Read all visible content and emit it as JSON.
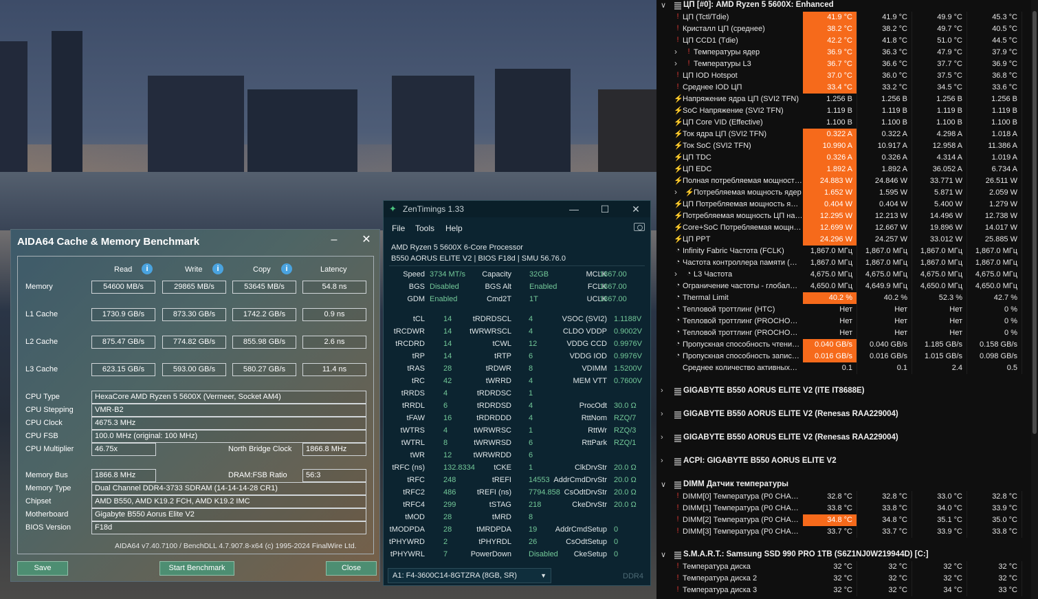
{
  "aida": {
    "title": "AIDA64 Cache & Memory Benchmark",
    "min": "–",
    "close": "✕",
    "cols": [
      "Read",
      "Write",
      "Copy",
      "Latency"
    ],
    "rows": [
      {
        "label": "Memory",
        "values": [
          "54600 MB/s",
          "29865 MB/s",
          "53645 MB/s",
          "54.8 ns"
        ]
      },
      {
        "label": "L1 Cache",
        "values": [
          "1730.9 GB/s",
          "873.30 GB/s",
          "1742.2 GB/s",
          "0.9 ns"
        ]
      },
      {
        "label": "L2 Cache",
        "values": [
          "875.47 GB/s",
          "774.82 GB/s",
          "855.98 GB/s",
          "2.6 ns"
        ]
      },
      {
        "label": "L3 Cache",
        "values": [
          "623.15 GB/s",
          "593.00 GB/s",
          "580.27 GB/s",
          "11.4 ns"
        ]
      }
    ],
    "cpu_type_label": "CPU Type",
    "cpu_type": "HexaCore AMD Ryzen 5 5600X  (Vermeer, Socket AM4)",
    "cpu_stepping_label": "CPU Stepping",
    "cpu_stepping": "VMR-B2",
    "cpu_clock_label": "CPU Clock",
    "cpu_clock": "4675.3 MHz",
    "cpu_fsb_label": "CPU FSB",
    "cpu_fsb": "100.0 MHz  (original: 100 MHz)",
    "cpu_mult_label": "CPU Multiplier",
    "cpu_mult": "46.75x",
    "nb_clock_label": "North Bridge Clock",
    "nb_clock": "1866.8 MHz",
    "mem_bus_label": "Memory Bus",
    "mem_bus": "1866.8 MHz",
    "dram_ratio_label": "DRAM:FSB Ratio",
    "dram_ratio": "56:3",
    "mem_type_label": "Memory Type",
    "mem_type": "Dual Channel DDR4-3733 SDRAM  (14-14-14-28 CR1)",
    "chipset_label": "Chipset",
    "chipset": "AMD B550, AMD K19.2 FCH, AMD K19.2 IMC",
    "mobo_label": "Motherboard",
    "mobo": "Gigabyte B550 Aorus Elite V2",
    "bios_label": "BIOS Version",
    "bios": "F18d",
    "footer": "AIDA64 v7.40.7100 / BenchDLL 4.7.907.8-x64  (c) 1995-2024 FinalWire Ltd.",
    "save": "Save",
    "start": "Start Benchmark",
    "close_btn": "Close"
  },
  "zen": {
    "title": "ZenTimings 1.33",
    "menu": [
      "File",
      "Tools",
      "Help"
    ],
    "cpu": "AMD Ryzen 5 5600X 6-Core Processor",
    "board": "B550 AORUS ELITE V2 | BIOS F18d | SMU 56.76.0",
    "top": [
      [
        "Speed",
        "3734 MT/s",
        "Capacity",
        "32GB",
        "MCLK",
        "1867.00"
      ],
      [
        "BGS",
        "Disabled",
        "BGS Alt",
        "Enabled",
        "FCLK",
        "1867.00"
      ],
      [
        "GDM",
        "Enabled",
        "Cmd2T",
        "1T",
        "UCLK",
        "1867.00"
      ]
    ],
    "timings": [
      [
        "tCL",
        "14",
        "tRDRDSCL",
        "4",
        "VSOC (SVI2)",
        "1.1188V"
      ],
      [
        "tRCDWR",
        "14",
        "tWRWRSCL",
        "4",
        "CLDO VDDP",
        "0.9002V"
      ],
      [
        "tRCDRD",
        "14",
        "tCWL",
        "12",
        "VDDG CCD",
        "0.9976V"
      ],
      [
        "tRP",
        "14",
        "tRTP",
        "6",
        "VDDG IOD",
        "0.9976V"
      ],
      [
        "tRAS",
        "28",
        "tRDWR",
        "8",
        "VDIMM",
        "1.5200V"
      ],
      [
        "tRC",
        "42",
        "tWRRD",
        "4",
        "MEM VTT",
        "0.7600V"
      ],
      [
        "tRRDS",
        "4",
        "tRDRDSC",
        "1",
        "",
        ""
      ],
      [
        "tRRDL",
        "6",
        "tRDRDSD",
        "4",
        "ProcOdt",
        "30.0 Ω"
      ],
      [
        "tFAW",
        "16",
        "tRDRDDD",
        "4",
        "RttNom",
        "RZQ/7"
      ],
      [
        "tWTRS",
        "4",
        "tWRWRSC",
        "1",
        "RttWr",
        "RZQ/3"
      ],
      [
        "tWTRL",
        "8",
        "tWRWRSD",
        "6",
        "RttPark",
        "RZQ/1"
      ],
      [
        "tWR",
        "12",
        "tWRWRDD",
        "6",
        "",
        ""
      ],
      [
        "tRFC (ns)",
        "132.8334",
        "tCKE",
        "1",
        "ClkDrvStr",
        "20.0 Ω"
      ],
      [
        "tRFC",
        "248",
        "tREFI",
        "14553",
        "AddrCmdDrvStr",
        "20.0 Ω"
      ],
      [
        "tRFC2",
        "486",
        "tREFI (ns)",
        "7794.858",
        "CsOdtDrvStr",
        "20.0 Ω"
      ],
      [
        "tRFC4",
        "299",
        "tSTAG",
        "218",
        "CkeDrvStr",
        "20.0 Ω"
      ],
      [
        "tMOD",
        "28",
        "tMRD",
        "8",
        "",
        ""
      ],
      [
        "tMODPDA",
        "28",
        "tMRDPDA",
        "19",
        "AddrCmdSetup",
        "0"
      ],
      [
        "tPHYWRD",
        "2",
        "tPHYRDL",
        "26",
        "CsOdtSetup",
        "0"
      ],
      [
        "tPHYWRL",
        "7",
        "PowerDown",
        "Disabled",
        "CkeSetup",
        "0"
      ]
    ],
    "module": "A1: F4-3600C14-8GTZRA (8GB, SR)",
    "ddr": "DDR4"
  },
  "hw": {
    "rows": [
      {
        "t": "h",
        "exp": "∨",
        "name": "ЦП [#0]: AMD Ryzen 5 5600X: Enhanced"
      },
      {
        "t": "s",
        "ic": "!",
        "icc": "#e53935",
        "ind": 0,
        "name": "ЦП (Tctl/Tdie)",
        "v": [
          "41.9 °C",
          "41.9 °C",
          "49.9 °C",
          "45.3 °C"
        ],
        "hot": true
      },
      {
        "t": "s",
        "ic": "!",
        "icc": "#e53935",
        "ind": 0,
        "name": "Кристалл ЦП (среднее)",
        "v": [
          "38.2 °C",
          "38.2 °C",
          "49.7 °C",
          "40.5 °C"
        ],
        "hot": true
      },
      {
        "t": "s",
        "ic": "!",
        "icc": "#e53935",
        "ind": 0,
        "name": "ЦП CCD1 (Tdie)",
        "v": [
          "42.2 °C",
          "41.8 °C",
          "51.0 °C",
          "44.5 °C"
        ],
        "hot": true
      },
      {
        "t": "s",
        "ic": "!",
        "icc": "#e53935",
        "ind": 1,
        "name": "Температуры ядер",
        "v": [
          "36.9 °C",
          "36.3 °C",
          "47.9 °C",
          "37.9 °C"
        ],
        "hot": true
      },
      {
        "t": "s",
        "ic": "!",
        "icc": "#e53935",
        "ind": 1,
        "name": "Температуры L3",
        "v": [
          "36.7 °C",
          "36.6 °C",
          "37.7 °C",
          "36.9 °C"
        ],
        "hot": true
      },
      {
        "t": "s",
        "ic": "!",
        "icc": "#e53935",
        "ind": 0,
        "name": "ЦП IOD Hotspot",
        "v": [
          "37.0 °C",
          "36.0 °C",
          "37.5 °C",
          "36.8 °C"
        ],
        "hot": true
      },
      {
        "t": "s",
        "ic": "!",
        "icc": "#e53935",
        "ind": 0,
        "name": "Среднее IOD ЦП",
        "v": [
          "33.4 °C",
          "33.2 °C",
          "34.5 °C",
          "33.6 °C"
        ],
        "hot": true
      },
      {
        "t": "s",
        "ic": "⚡",
        "icc": "#f5c518",
        "ind": 0,
        "name": "Напряжение ядра ЦП (SVI2 TFN)",
        "v": [
          "1.256 В",
          "1.256 В",
          "1.256 В",
          "1.256 В"
        ],
        "hot": false
      },
      {
        "t": "s",
        "ic": "⚡",
        "icc": "#f5c518",
        "ind": 0,
        "name": "SoC Напряжение (SVI2 TFN)",
        "v": [
          "1.119 В",
          "1.119 В",
          "1.119 В",
          "1.119 В"
        ],
        "hot": false
      },
      {
        "t": "s",
        "ic": "⚡",
        "icc": "#f5c518",
        "ind": 0,
        "name": "ЦП Core VID (Effective)",
        "v": [
          "1.100 В",
          "1.100 В",
          "1.100 В",
          "1.100 В"
        ],
        "hot": false
      },
      {
        "t": "s",
        "ic": "⚡",
        "icc": "#f5c518",
        "ind": 0,
        "name": "Ток ядра ЦП (SVI2 TFN)",
        "v": [
          "0.322 A",
          "0.322 A",
          "4.298 A",
          "1.018 A"
        ],
        "hot": true
      },
      {
        "t": "s",
        "ic": "⚡",
        "icc": "#f5c518",
        "ind": 0,
        "name": "Ток SoC (SVI2 TFN)",
        "v": [
          "10.990 A",
          "10.917 A",
          "12.958 A",
          "11.386 A"
        ],
        "hot": true
      },
      {
        "t": "s",
        "ic": "⚡",
        "icc": "#f5c518",
        "ind": 0,
        "name": "ЦП TDC",
        "v": [
          "0.326 A",
          "0.326 A",
          "4.314 A",
          "1.019 A"
        ],
        "hot": true
      },
      {
        "t": "s",
        "ic": "⚡",
        "icc": "#f5c518",
        "ind": 0,
        "name": "ЦП EDC",
        "v": [
          "1.892 A",
          "1.892 A",
          "36.052 A",
          "6.734 A"
        ],
        "hot": true
      },
      {
        "t": "s",
        "ic": "⚡",
        "icc": "#f5c518",
        "ind": 0,
        "name": "Полная потребляемая мощност…",
        "v": [
          "24.883 W",
          "24.846 W",
          "33.771 W",
          "26.511 W"
        ],
        "hot": true
      },
      {
        "t": "s",
        "ic": "⚡",
        "icc": "#f5c518",
        "ind": 1,
        "name": "Потребляемая мощность ядер",
        "v": [
          "1.652 W",
          "1.595 W",
          "5.871 W",
          "2.059 W"
        ],
        "hot": true
      },
      {
        "t": "s",
        "ic": "⚡",
        "icc": "#f5c518",
        "ind": 0,
        "name": "ЦП Потребляемая мощность я…",
        "v": [
          "0.404 W",
          "0.404 W",
          "5.400 W",
          "1.279 W"
        ],
        "hot": true
      },
      {
        "t": "s",
        "ic": "⚡",
        "icc": "#f5c518",
        "ind": 0,
        "name": "Потребляемая мощность ЦП на…",
        "v": [
          "12.295 W",
          "12.213 W",
          "14.496 W",
          "12.738 W"
        ],
        "hot": true
      },
      {
        "t": "s",
        "ic": "⚡",
        "icc": "#f5c518",
        "ind": 0,
        "name": "Core+SoC Потребляемая мощн…",
        "v": [
          "12.699 W",
          "12.667 W",
          "19.896 W",
          "14.017 W"
        ],
        "hot": true
      },
      {
        "t": "s",
        "ic": "⚡",
        "icc": "#f5c518",
        "ind": 0,
        "name": "ЦП PPT",
        "v": [
          "24.296 W",
          "24.257 W",
          "33.012 W",
          "25.885 W"
        ],
        "hot": true
      },
      {
        "t": "s",
        "ic": "◔",
        "icc": "#cfcfcf",
        "ind": 0,
        "name": "Infinity Fabric Частота (FCLK)",
        "v": [
          "1,867.0 МГц",
          "1,867.0 МГц",
          "1,867.0 МГц",
          "1,867.0 МГц"
        ],
        "hot": false
      },
      {
        "t": "s",
        "ic": "◔",
        "icc": "#cfcfcf",
        "ind": 0,
        "name": "Частота контроллера памяти (…",
        "v": [
          "1,867.0 МГц",
          "1,867.0 МГц",
          "1,867.0 МГц",
          "1,867.0 МГц"
        ],
        "hot": false
      },
      {
        "t": "s",
        "ic": "◔",
        "icc": "#cfcfcf",
        "ind": 1,
        "name": "L3 Частота",
        "v": [
          "4,675.0 МГц",
          "4,675.0 МГц",
          "4,675.0 МГц",
          "4,675.0 МГц"
        ],
        "hot": false
      },
      {
        "t": "s",
        "ic": "◔",
        "icc": "#cfcfcf",
        "ind": 0,
        "name": "Ограничение частоты - глобал…",
        "v": [
          "4,650.0 МГц",
          "4,649.9 МГц",
          "4,650.0 МГц",
          "4,650.0 МГц"
        ],
        "hot": false
      },
      {
        "t": "s",
        "ic": "◔",
        "icc": "#cfcfcf",
        "ind": 0,
        "name": "Thermal Limit",
        "v": [
          "40.2 %",
          "40.2 %",
          "52.3 %",
          "42.7 %"
        ],
        "hot": true
      },
      {
        "t": "s",
        "ic": "◔",
        "icc": "#cfcfcf",
        "ind": 0,
        "name": "Тепловой троттлинг (HTC)",
        "v": [
          "Нет",
          "Нет",
          "Нет",
          "0 %"
        ],
        "hot": false
      },
      {
        "t": "s",
        "ic": "◔",
        "icc": "#cfcfcf",
        "ind": 0,
        "name": "Тепловой троттлинг (PROCHO…",
        "v": [
          "Нет",
          "Нет",
          "Нет",
          "0 %"
        ],
        "hot": false
      },
      {
        "t": "s",
        "ic": "◔",
        "icc": "#cfcfcf",
        "ind": 0,
        "name": "Тепловой троттлинг (PROCHO…",
        "v": [
          "Нет",
          "Нет",
          "Нет",
          "0 %"
        ],
        "hot": false
      },
      {
        "t": "s",
        "ic": "◔",
        "icc": "#cfcfcf",
        "ind": 0,
        "name": "Пропускная способность чтени…",
        "v": [
          "0.040 GB/s",
          "0.040 GB/s",
          "1.185 GB/s",
          "0.158 GB/s"
        ],
        "hot": true
      },
      {
        "t": "s",
        "ic": "◔",
        "icc": "#cfcfcf",
        "ind": 0,
        "name": "Пропускная способность запис…",
        "v": [
          "0.016 GB/s",
          "0.016 GB/s",
          "1.015 GB/s",
          "0.098 GB/s"
        ],
        "hot": true
      },
      {
        "t": "s",
        "ic": "",
        "icc": "#cfcfcf",
        "ind": 0,
        "name": "Среднее количество активных…",
        "v": [
          "0.1",
          "0.1",
          "2.4",
          "0.5"
        ],
        "hot": false
      },
      {
        "t": "g"
      },
      {
        "t": "h",
        "exp": "›",
        "name": "GIGABYTE B550 AORUS ELITE V2 (ITE IT8688E)"
      },
      {
        "t": "g"
      },
      {
        "t": "h",
        "exp": "›",
        "name": "GIGABYTE B550 AORUS ELITE V2 (Renesas RAA229004)"
      },
      {
        "t": "g"
      },
      {
        "t": "h",
        "exp": "›",
        "name": "GIGABYTE B550 AORUS ELITE V2 (Renesas RAA229004)"
      },
      {
        "t": "g"
      },
      {
        "t": "h",
        "exp": "›",
        "name": "ACPI: GIGABYTE B550 AORUS ELITE V2"
      },
      {
        "t": "g"
      },
      {
        "t": "h",
        "exp": "∨",
        "name": "DIMM Датчик температуры"
      },
      {
        "t": "s",
        "ic": "!",
        "icc": "#e53935",
        "ind": 0,
        "name": "DIMM[0] Температура (P0 CHA…",
        "v": [
          "32.8 °C",
          "32.8 °C",
          "33.0 °C",
          "32.8 °C"
        ],
        "hot": false
      },
      {
        "t": "s",
        "ic": "!",
        "icc": "#e53935",
        "ind": 0,
        "name": "DIMM[1] Температура (P0 CHA…",
        "v": [
          "33.8 °C",
          "33.8 °C",
          "34.0 °C",
          "33.9 °C"
        ],
        "hot": false
      },
      {
        "t": "s",
        "ic": "!",
        "icc": "#e53935",
        "ind": 0,
        "name": "DIMM[2] Температура (P0 CHA…",
        "v": [
          "34.8 °C",
          "34.8 °C",
          "35.1 °C",
          "35.0 °C"
        ],
        "hot": true
      },
      {
        "t": "s",
        "ic": "!",
        "icc": "#e53935",
        "ind": 0,
        "name": "DIMM[3] Температура (P0 CHA…",
        "v": [
          "33.7 °C",
          "33.7 °C",
          "33.9 °C",
          "33.8 °C"
        ],
        "hot": false
      },
      {
        "t": "g"
      },
      {
        "t": "h",
        "exp": "∨",
        "name": "S.M.A.R.T.: Samsung SSD 990 PRO 1TB (S6Z1NJ0W219944D) [C:]"
      },
      {
        "t": "s",
        "ic": "!",
        "icc": "#e53935",
        "ind": 0,
        "name": "Температура диска",
        "v": [
          "32 °C",
          "32 °C",
          "32 °C",
          "32 °C"
        ],
        "hot": false
      },
      {
        "t": "s",
        "ic": "!",
        "icc": "#e53935",
        "ind": 0,
        "name": "Температура диска 2",
        "v": [
          "32 °C",
          "32 °C",
          "32 °C",
          "32 °C"
        ],
        "hot": false
      },
      {
        "t": "s",
        "ic": "!",
        "icc": "#e53935",
        "ind": 0,
        "name": "Температура диска 3",
        "v": [
          "32 °C",
          "32 °C",
          "34 °C",
          "33 °C"
        ],
        "hot": false
      }
    ]
  }
}
